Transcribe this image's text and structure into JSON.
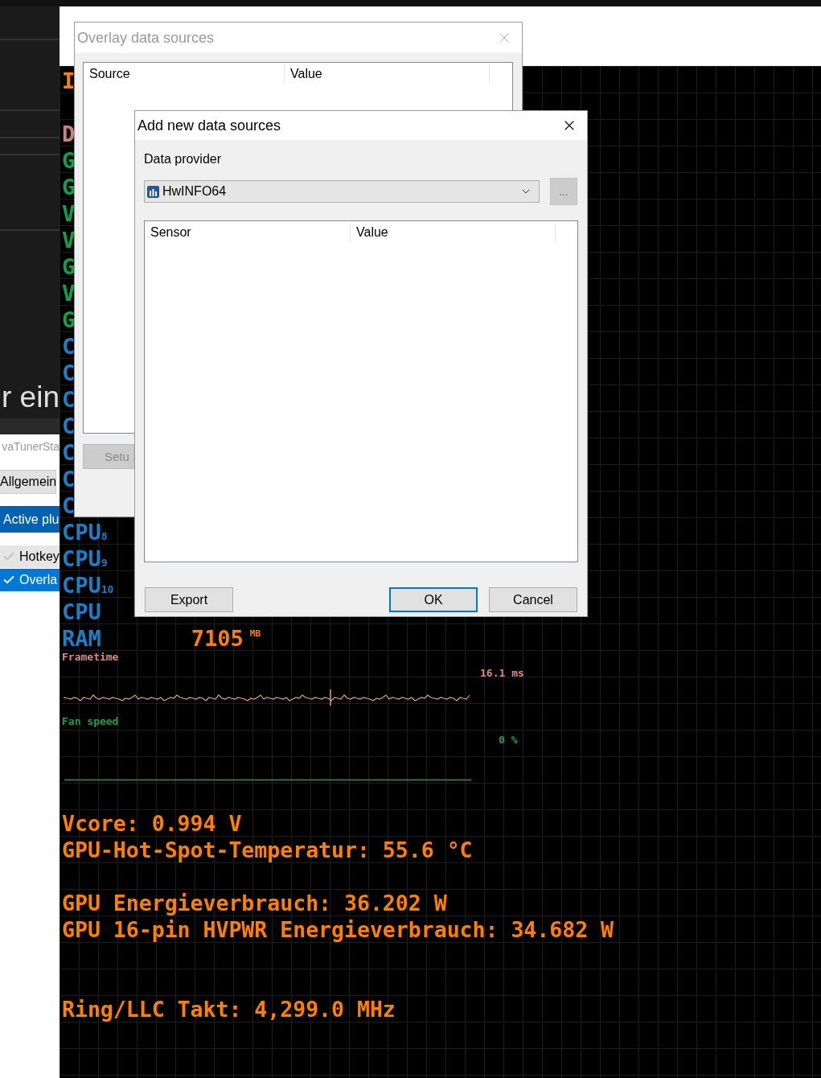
{
  "background_window": {
    "heading": "r ein",
    "title": "vaTunerSta",
    "tab": "Allgemein",
    "section": "Active plu",
    "plugins": [
      {
        "label": "Hotkey",
        "checked": false,
        "selected": false
      },
      {
        "label": "Overla",
        "checked": true,
        "selected": true
      }
    ]
  },
  "overlay": {
    "rows": [
      {
        "kind": "text",
        "label": "I",
        "color": "#ff8000"
      },
      {
        "kind": "gap"
      },
      {
        "kind": "text",
        "label": "D",
        "color": "#c88080"
      },
      {
        "kind": "text",
        "label": "G",
        "color": "#11a045"
      },
      {
        "kind": "text",
        "label": "G",
        "color": "#11a045"
      },
      {
        "kind": "text",
        "label": "V",
        "color": "#11a045"
      },
      {
        "kind": "text",
        "label": "V",
        "color": "#11a045"
      },
      {
        "kind": "text",
        "label": "G",
        "color": "#11a045"
      },
      {
        "kind": "text",
        "label": "V",
        "color": "#11a045"
      },
      {
        "kind": "text",
        "label": "G",
        "color": "#11a045"
      },
      {
        "kind": "text",
        "label": "C",
        "color": "#1a7fc8"
      },
      {
        "kind": "text",
        "label": "C",
        "color": "#1a7fc8"
      },
      {
        "kind": "text",
        "label": "C",
        "color": "#1a7fc8"
      },
      {
        "kind": "text",
        "label": "C",
        "color": "#1a7fc8"
      },
      {
        "kind": "text",
        "label": "C",
        "color": "#1a7fc8"
      },
      {
        "kind": "text",
        "label": "C",
        "color": "#1a7fc8"
      },
      {
        "kind": "text",
        "label": "C",
        "color": "#1a7fc8"
      },
      {
        "kind": "text",
        "label": "CPU$_{8}$",
        "color": "#1a7fc8"
      },
      {
        "kind": "text",
        "label": "CPU$_{9}$",
        "color": "#1a7fc8"
      },
      {
        "kind": "text",
        "label": "CPU$_{10}$",
        "color": "#1a7fc8"
      },
      {
        "kind": "text",
        "label": "CPU",
        "color": "#1a7fc8"
      },
      {
        "kind": "text",
        "label": "RAM",
        "color": "#1a7fc8",
        "value": "7105",
        "unit": "MB"
      }
    ],
    "frametime": {
      "label": "Frametime",
      "reading": "16.1 ms"
    },
    "fan_speed": {
      "label": "Fan speed",
      "reading": "0 %"
    },
    "lines": [
      {
        "kind": "text",
        "text": "Vcore: 0.994 V"
      },
      {
        "kind": "text",
        "text": "GPU-Hot-Spot-Temperatur: 55.6 °C"
      },
      {
        "kind": "gap"
      },
      {
        "kind": "text",
        "text": "GPU Energieverbrauch: 36.202 W"
      },
      {
        "kind": "text",
        "text": "GPU 16-pin HVPWR Energieverbrauch: 34.682 W"
      },
      {
        "kind": "gap"
      },
      {
        "kind": "gap"
      },
      {
        "kind": "text",
        "text": "Ring/LLC Takt: 4,299.0 MHz"
      }
    ]
  },
  "sources_dialog": {
    "title": "Overlay data sources",
    "columns": [
      "Source",
      "Value"
    ],
    "setup_button": "Setu"
  },
  "add_dialog": {
    "title": "Add new data sources",
    "provider_label": "Data provider",
    "provider": "HwINFO64",
    "browse_button": "...",
    "columns": [
      "Sensor",
      "Value"
    ],
    "buttons": [
      {
        "label": "Export",
        "kind": "plain"
      },
      {
        "label": "OK",
        "kind": "default"
      },
      {
        "label": "Cancel",
        "kind": "plain"
      }
    ]
  }
}
